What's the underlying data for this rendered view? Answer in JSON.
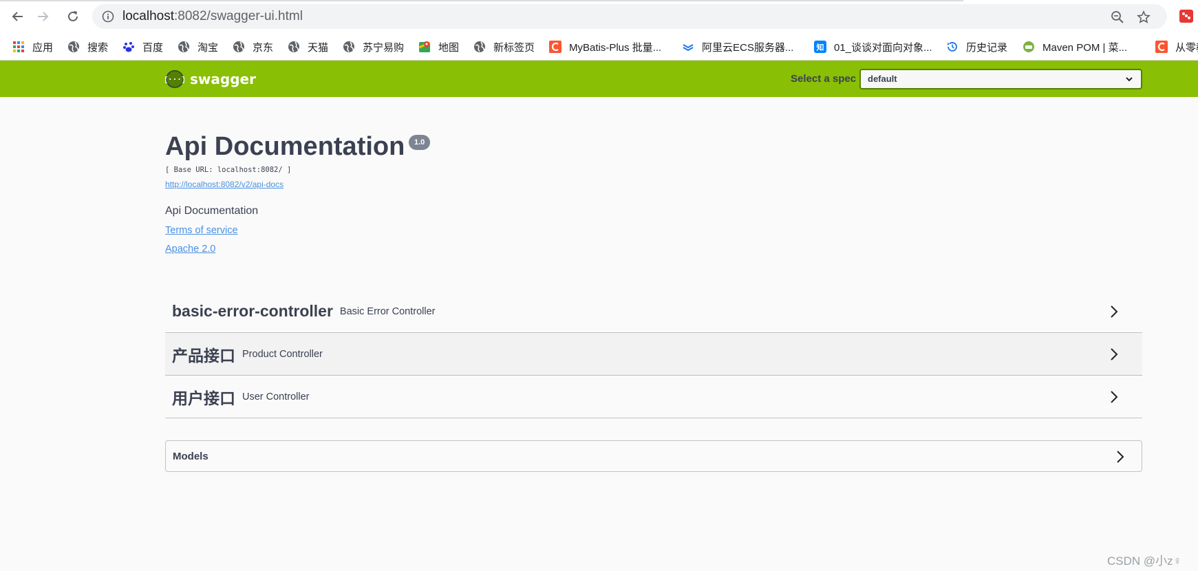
{
  "browser": {
    "url_host": "localhost",
    "url_path": ":8082/swagger-ui.html",
    "bookmarks": [
      {
        "label": "应用",
        "icon": "apps-grid-icon"
      },
      {
        "label": "搜索",
        "icon": "globe-icon"
      },
      {
        "label": "百度",
        "icon": "baidu-paw-icon"
      },
      {
        "label": "淘宝",
        "icon": "globe-icon"
      },
      {
        "label": "京东",
        "icon": "globe-icon"
      },
      {
        "label": "天猫",
        "icon": "globe-icon"
      },
      {
        "label": "苏宁易购",
        "icon": "globe-icon"
      },
      {
        "label": "地图",
        "icon": "maps-pin-icon"
      },
      {
        "label": "新标签页",
        "icon": "globe-icon"
      },
      {
        "label": "MyBatis-Plus 批量...",
        "icon": "csdn-c-icon"
      },
      {
        "label": "阿里云ECS服务器...",
        "icon": "aliyun-icon"
      },
      {
        "label": "01_谈谈对面向对象...",
        "icon": "zhihu-icon"
      },
      {
        "label": "历史记录",
        "icon": "history-icon"
      },
      {
        "label": "Maven POM | 菜...",
        "icon": "runoob-icon"
      },
      {
        "label": "从零教",
        "icon": "csdn-c-icon"
      }
    ]
  },
  "topbar": {
    "logo_text": "swagger",
    "spec_label": "Select a spec",
    "spec_selected": "default",
    "color": "#89bf04"
  },
  "info": {
    "title": "Api Documentation",
    "version": "1.0",
    "base_url": "[ Base URL: localhost:8082/ ]",
    "api_docs_link": "http://localhost:8082/v2/api-docs",
    "description": "Api Documentation",
    "terms_link": "Terms of service",
    "license_link": "Apache 2.0"
  },
  "tags": [
    {
      "name": "basic-error-controller",
      "description": "Basic Error Controller"
    },
    {
      "name": "产品接口",
      "description": "Product Controller"
    },
    {
      "name": "用户接口",
      "description": "User Controller"
    }
  ],
  "models": {
    "label": "Models"
  },
  "watermark": "CSDN @小z♀",
  "colors": {
    "link": "#4990e2",
    "text": "#3b4151",
    "badge": "#7d8492"
  }
}
